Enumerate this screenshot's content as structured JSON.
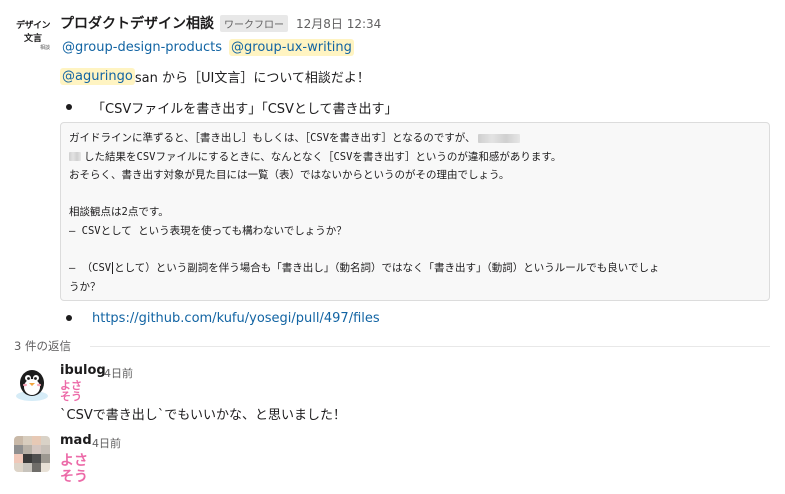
{
  "message": {
    "app_avatar": {
      "line1": "デザイン",
      "line2": "文言",
      "line3": "相談"
    },
    "app_name": "プロダクトデザイン相談",
    "app_badge": "ワークフロー",
    "timestamp": "12月8日 12:34",
    "mentions": [
      "@group-design-products",
      "@group-ux-writing"
    ],
    "intro": {
      "mention": "@aguringo",
      "text": "san から［UI文言］について相談だよ！"
    },
    "bullet1": "「CSVファイルを書き出す」「CSVとして書き出す」",
    "code_lines": [
      "ガイドラインに準ずると、［書き出し］もしくは、［CSVを書き出す］となるのですが、",
      "した結果をCSVファイルにするときに、なんとなく［CSVを書き出す］というのが違和感があります。",
      "おそらく、書き出す対象が見た目には一覧（表）ではないからというのがその理由でしょう。",
      "",
      "相談観点は2点です。",
      "– CSVとして という表現を使っても構わないでしょうか？",
      "",
      "– （CSV",
      "として）という副詞を伴う場合も「書き出し」（動名詞）ではなく「書き出す」（動詞）というルールでも良いでしょ",
      "うか？"
    ],
    "bullet2_link": "https://github.com/kufu/yosegi/pull/497/files"
  },
  "replies_label": "3 件の返信",
  "replies": [
    {
      "name": "ibulog",
      "time": "4日前",
      "emoji": "よさそう",
      "emoji_line1": "よさ",
      "emoji_line2": "そう",
      "text": "`CSVで書き出し`でもいいかな、と思いました！",
      "avatar_icon": "penguin-icon"
    },
    {
      "name": "mad",
      "time": "4日前",
      "emoji_line1": "よさ",
      "emoji_line2": "そう",
      "avatar_icon": "pixelated-avatar",
      "avatar_colors": [
        "#c9b9a8",
        "#d8cdbe",
        "#e7c9b5",
        "#d9d2c7",
        "#8f8f8f",
        "#b8b1a7",
        "#d4c6c0",
        "#c7c0b8",
        "#f0c8b9",
        "#3a3a3a",
        "#505050",
        "#9c9890",
        "#ddd4c8",
        "#c7c3bc",
        "#6f6d69",
        "#e8e1d6"
      ]
    }
  ],
  "colors": {
    "link": "#1264a3",
    "mention_bg": "#fff4c2",
    "emoji_pink": "#ec6aa8"
  }
}
